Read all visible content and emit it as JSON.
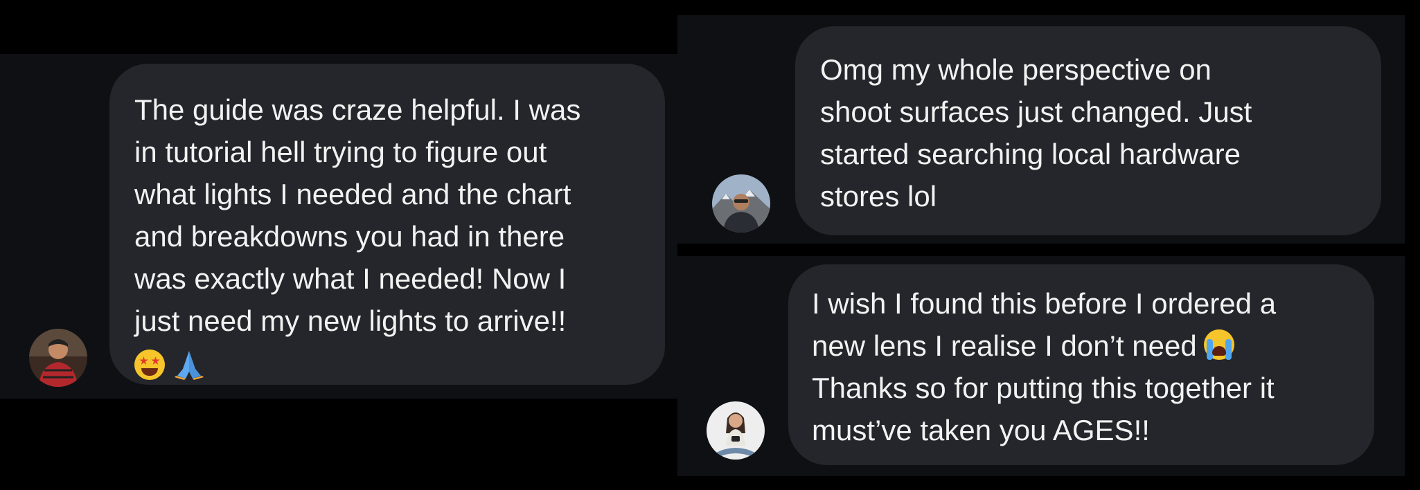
{
  "conversations": [
    {
      "message_lines": [
        "The guide was craze helpful. I was",
        "in tutorial hell trying to figure out",
        "what lights I needed and the chart",
        "and breakdowns you had in there",
        "was exactly what I needed! Now I",
        "just need my new lights to arrive!!"
      ],
      "emojis": [
        "star-struck-emoji",
        "folded-hands-emoji"
      ],
      "avatar": "avatar-man-red-jacket"
    },
    {
      "message_lines": [
        "Omg my whole perspective on",
        "shoot surfaces just changed. Just",
        "started searching local hardware",
        "stores lol"
      ],
      "avatar": "avatar-man-mountains"
    },
    {
      "message_lines": [
        "I wish I found this before I ordered a",
        "new lens I realise I don’t need",
        "Thanks so for putting this together it",
        "must’ve taken you AGES!!"
      ],
      "emojis": [
        "loudly-crying-emoji"
      ],
      "avatar": "avatar-woman-sitting"
    }
  ],
  "colors": {
    "page_background": "#000000",
    "panel_background": "#0e1014",
    "bubble_background": "#25262b",
    "text": "#f2f2f2"
  }
}
